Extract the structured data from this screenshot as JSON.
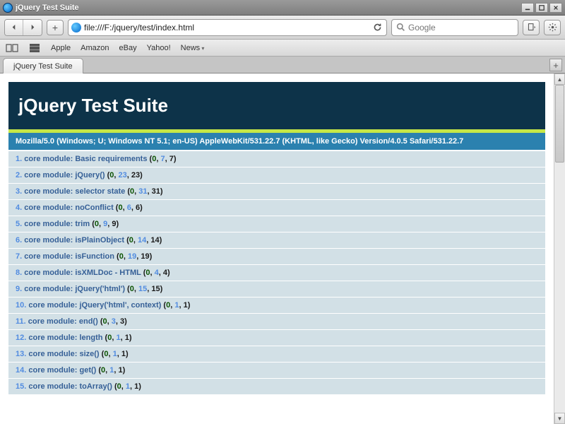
{
  "window": {
    "title": "jQuery Test Suite"
  },
  "toolbar": {
    "url": "file:///F:/jquery/test/index.html",
    "search_placeholder": "Google",
    "add_label": "+"
  },
  "bookmarks": {
    "items": [
      {
        "label": "Apple",
        "menu": false
      },
      {
        "label": "Amazon",
        "menu": false
      },
      {
        "label": "eBay",
        "menu": false
      },
      {
        "label": "Yahoo!",
        "menu": false
      },
      {
        "label": "News",
        "menu": true
      }
    ]
  },
  "tabs": {
    "active": "jQuery Test Suite",
    "new_label": "+"
  },
  "page": {
    "title": "jQuery Test Suite",
    "user_agent": "Mozilla/5.0 (Windows; U; Windows NT 5.1; en-US) AppleWebKit/531.22.7 (KHTML, like Gecko) Version/4.0.5 Safari/531.22.7",
    "tests": [
      {
        "n": "1.",
        "name": "core module: Basic requirements",
        "c": [
          "0",
          "7",
          "7"
        ]
      },
      {
        "n": "2.",
        "name": "core module: jQuery()",
        "c": [
          "0",
          "23",
          "23"
        ]
      },
      {
        "n": "3.",
        "name": "core module: selector state",
        "c": [
          "0",
          "31",
          "31"
        ]
      },
      {
        "n": "4.",
        "name": "core module: noConflict",
        "c": [
          "0",
          "6",
          "6"
        ]
      },
      {
        "n": "5.",
        "name": "core module: trim",
        "c": [
          "0",
          "9",
          "9"
        ]
      },
      {
        "n": "6.",
        "name": "core module: isPlainObject",
        "c": [
          "0",
          "14",
          "14"
        ]
      },
      {
        "n": "7.",
        "name": "core module: isFunction",
        "c": [
          "0",
          "19",
          "19"
        ]
      },
      {
        "n": "8.",
        "name": "core module: isXMLDoc - HTML",
        "c": [
          "0",
          "4",
          "4"
        ]
      },
      {
        "n": "9.",
        "name": "core module: jQuery('html')",
        "c": [
          "0",
          "15",
          "15"
        ]
      },
      {
        "n": "10.",
        "name": "core module: jQuery('html', context)",
        "c": [
          "0",
          "1",
          "1"
        ]
      },
      {
        "n": "11.",
        "name": "core module: end()",
        "c": [
          "0",
          "3",
          "3"
        ]
      },
      {
        "n": "12.",
        "name": "core module: length",
        "c": [
          "0",
          "1",
          "1"
        ]
      },
      {
        "n": "13.",
        "name": "core module: size()",
        "c": [
          "0",
          "1",
          "1"
        ]
      },
      {
        "n": "14.",
        "name": "core module: get()",
        "c": [
          "0",
          "1",
          "1"
        ]
      },
      {
        "n": "15.",
        "name": "core module: toArray()",
        "c": [
          "0",
          "1",
          "1"
        ]
      }
    ]
  }
}
